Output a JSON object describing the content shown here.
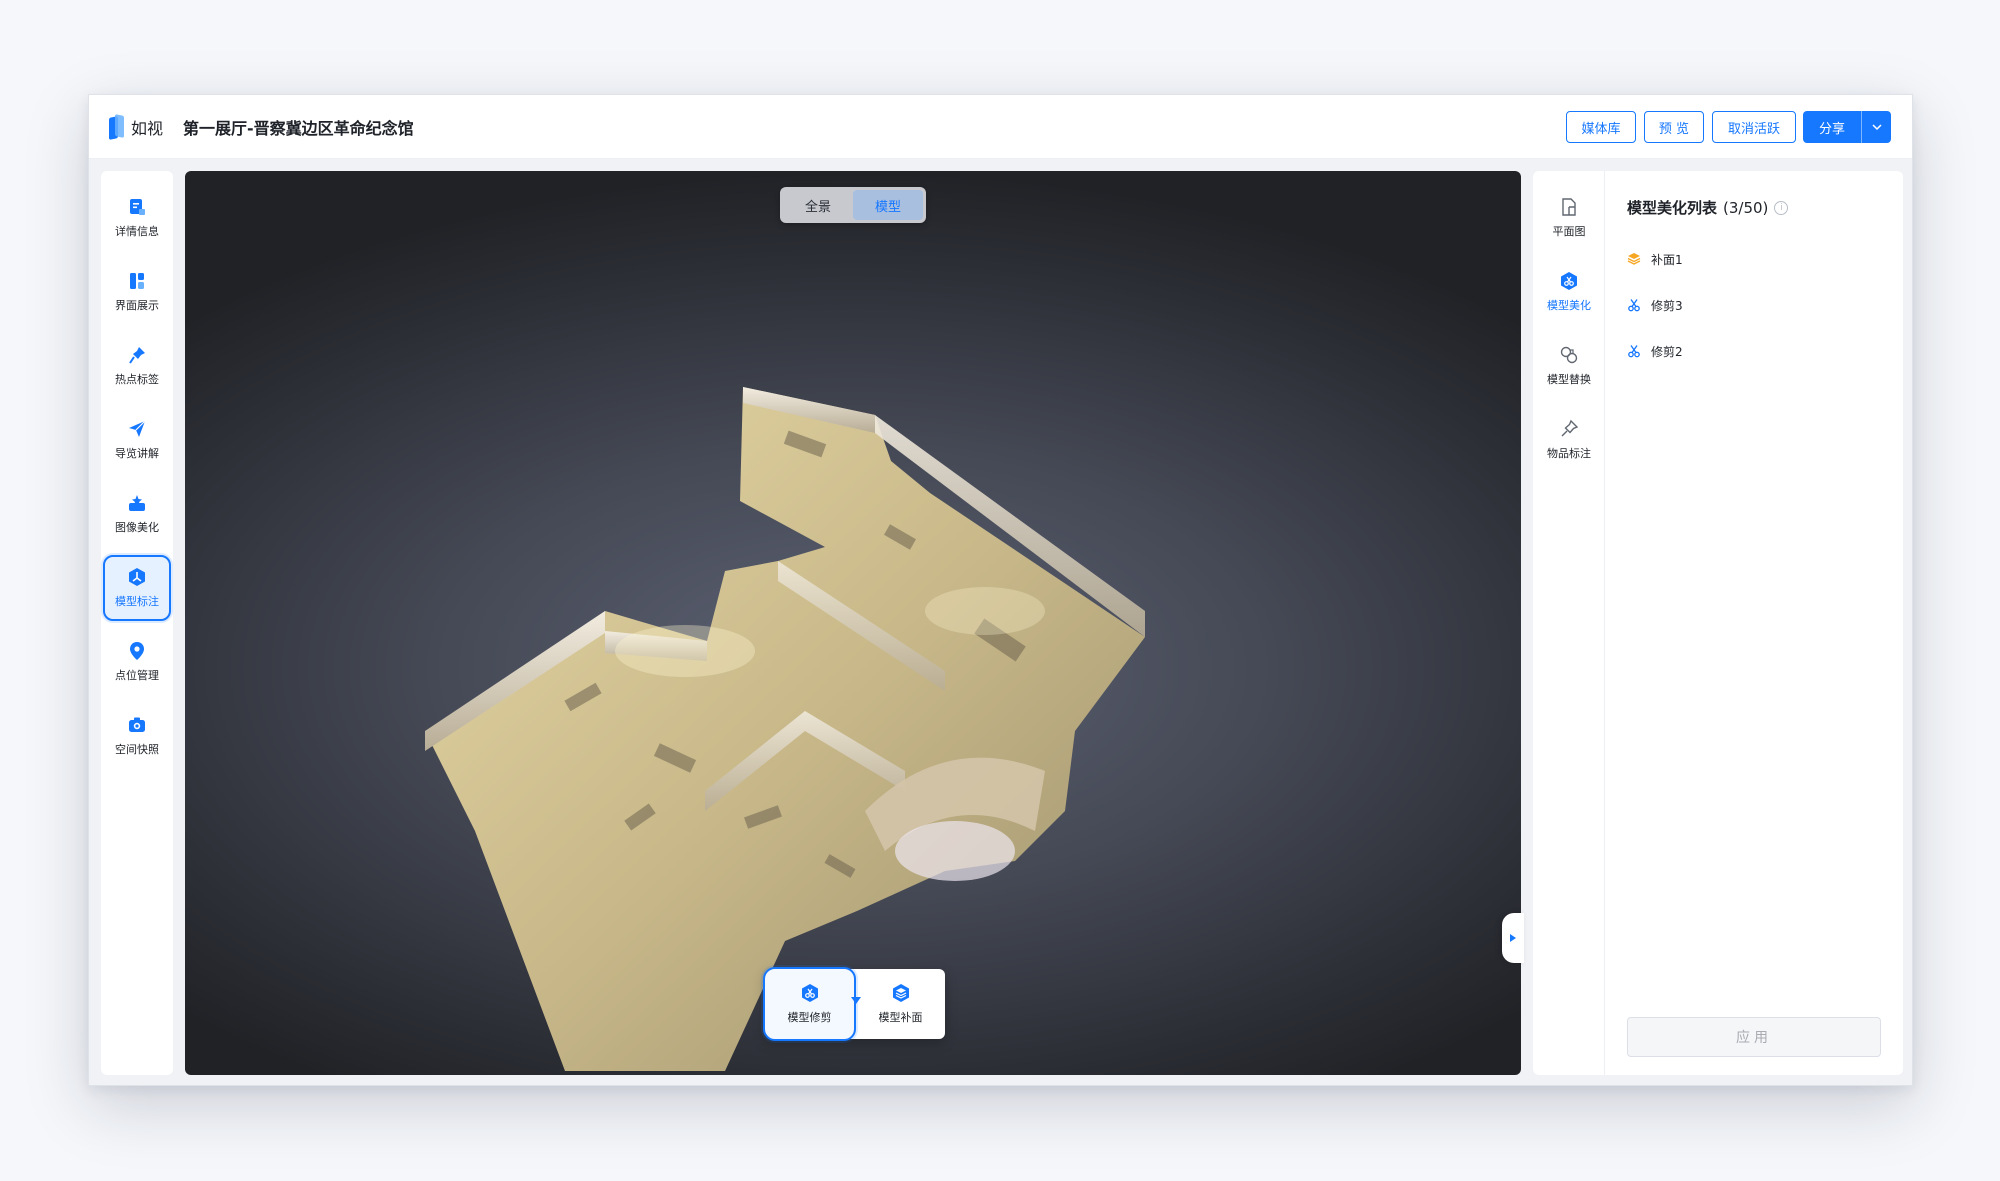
{
  "app": {
    "logo_text": "如视",
    "title": "第一展厅-晋察冀边区革命纪念馆"
  },
  "header_buttons": {
    "media": "媒体库",
    "preview": "预 览",
    "cancel_activate": "取消活跃",
    "share": "分享"
  },
  "left_nav": [
    {
      "label": "详情信息",
      "icon": "detail-icon"
    },
    {
      "label": "界面展示",
      "icon": "layout-icon"
    },
    {
      "label": "热点标签",
      "icon": "pin-icon"
    },
    {
      "label": "导览讲解",
      "icon": "send-icon"
    },
    {
      "label": "图像美化",
      "icon": "image-enhance-icon"
    },
    {
      "label": "模型标注",
      "icon": "model-annotate-icon",
      "active": true
    },
    {
      "label": "点位管理",
      "icon": "location-icon"
    },
    {
      "label": "空间快照",
      "icon": "camera-icon"
    }
  ],
  "view_toggle": {
    "panorama": "全景",
    "model": "模型",
    "active": "模型"
  },
  "bottom_tools": [
    {
      "label": "模型修剪",
      "icon": "scissors-icon",
      "active": true
    },
    {
      "label": "模型补面",
      "icon": "layers-icon"
    }
  ],
  "right_nav": [
    {
      "label": "平面图",
      "icon": "floorplan-icon"
    },
    {
      "label": "模型美化",
      "icon": "model-beautify-icon",
      "active": true
    },
    {
      "label": "模型替换",
      "icon": "replace-icon"
    },
    {
      "label": "物品标注",
      "icon": "pushpin-icon"
    }
  ],
  "right_panel": {
    "title": "模型美化列表",
    "count": "(3/50)",
    "items": [
      {
        "label": "补面1",
        "icon": "layers-icon",
        "color": "#f5a623"
      },
      {
        "label": "修剪3",
        "icon": "scissors-icon",
        "color": "#1677ff"
      },
      {
        "label": "修剪2",
        "icon": "scissors-icon",
        "color": "#1677ff"
      }
    ],
    "apply_label": "应用"
  },
  "colors": {
    "primary": "#1677ff",
    "accent_orange": "#f5a623"
  }
}
